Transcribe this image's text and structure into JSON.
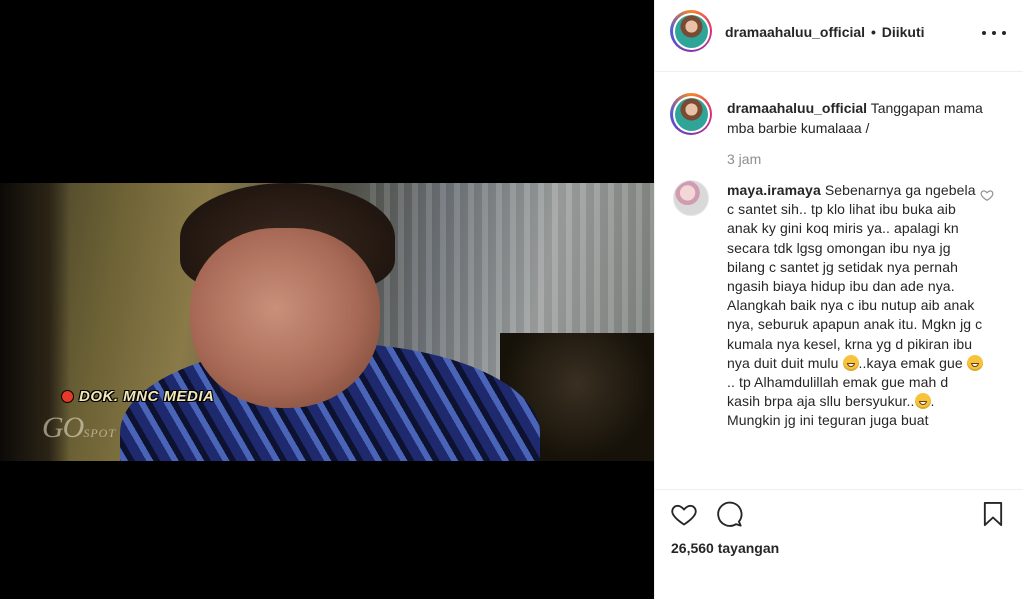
{
  "video": {
    "overlay_label": "DOK. MNC MEDIA",
    "logo_main": "GO",
    "logo_sub": "SPOT"
  },
  "header": {
    "username": "dramaahaluu_official",
    "separator": "•",
    "follow_status": "Diikuti"
  },
  "caption": {
    "username": "dramaahaluu_official",
    "text": "Tanggapan mama mba barbie kumalaaa /",
    "time": "3 jam"
  },
  "comment": {
    "username": "maya.iramaya",
    "text_part1": "Sebenarnya ga ngebela c santet sih.. tp klo lihat ibu buka aib anak ky gini koq miris ya.. apalagi kn secara tdk lgsg omongan ibu nya jg bilang c santet jg setidak nya pernah ngasih biaya hidup ibu dan ade nya. Alangkah baik nya c ibu nutup aib anak nya, seburuk apapun anak itu. Mgkn jg c kumala nya kesel, krna yg d pikiran ibu nya duit duit mulu ",
    "text_part2": "..kaya emak gue ",
    "text_part3": ".. tp Alhamdulillah emak gue mah d kasih brpa aja sllu bersyukur..",
    "text_part4": ". Mungkin jg ini teguran juga buat",
    "emoji_names": [
      "grinning-face",
      "beaming-face",
      "grinning-squinting-face"
    ]
  },
  "stats": {
    "views": "26,560 tayangan"
  },
  "icons": {
    "header_more": "more-options-icon",
    "like": "heart-icon",
    "comment": "comment-bubble-icon",
    "save": "bookmark-icon"
  },
  "colors": {
    "text_primary": "#262626",
    "text_secondary": "#8e8e8e",
    "border": "#efefef",
    "media_bg": "#000000"
  }
}
